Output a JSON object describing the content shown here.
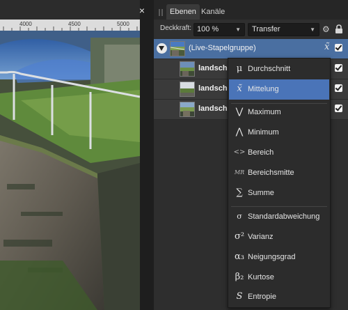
{
  "canvas": {
    "ruler_ticks": [
      "4000",
      "4500",
      "5000"
    ],
    "close_glyph": "×"
  },
  "panel": {
    "tabs": [
      {
        "label": "Ebenen",
        "active": true
      },
      {
        "label": "Kanäle",
        "active": false
      }
    ],
    "opacity_label": "Deckkraft:",
    "opacity_value": "100 %",
    "blend_mode": "Transfer",
    "dropdown_arrow": "▼",
    "layers": [
      {
        "name": "(Live-Stapelgruppe)",
        "visible": true,
        "selected": true,
        "kind": "group"
      },
      {
        "name": "landsch",
        "visible": true,
        "selected": false,
        "kind": "image"
      },
      {
        "name": "landsch",
        "visible": true,
        "selected": false,
        "kind": "image"
      },
      {
        "name": "landsch",
        "visible": true,
        "selected": false,
        "kind": "image"
      }
    ],
    "group_icon_glyph": "x̃"
  },
  "menu": {
    "items": [
      {
        "icon": "μ",
        "label": "Durchschnitt",
        "highlighted": false
      },
      {
        "icon": "x̃",
        "label": "Mittelung",
        "highlighted": true
      },
      {
        "icon": "⋁",
        "label": "Maximum",
        "highlighted": false
      },
      {
        "icon": "⋀",
        "label": "Minimum",
        "highlighted": false
      },
      {
        "icon": "<>",
        "label": "Bereich",
        "highlighted": false
      },
      {
        "icon": "MR",
        "label": "Bereichsmitte",
        "highlighted": false
      },
      {
        "icon": "∑",
        "label": "Summe",
        "highlighted": false
      },
      {
        "icon": "σ",
        "label": "Standardabweichung",
        "highlighted": false
      },
      {
        "icon": "σ²",
        "label": "Varianz",
        "highlighted": false
      },
      {
        "icon": "α₃",
        "label": "Neigungsgrad",
        "highlighted": false
      },
      {
        "icon": "β₂",
        "label": "Kurtose",
        "highlighted": false
      },
      {
        "icon": "S",
        "label": "Entropie",
        "highlighted": false
      }
    ]
  },
  "colors": {
    "panel_bg": "#2e2e2e",
    "selection": "#4a6fa1",
    "menu_highlight": "#4a74b8"
  }
}
